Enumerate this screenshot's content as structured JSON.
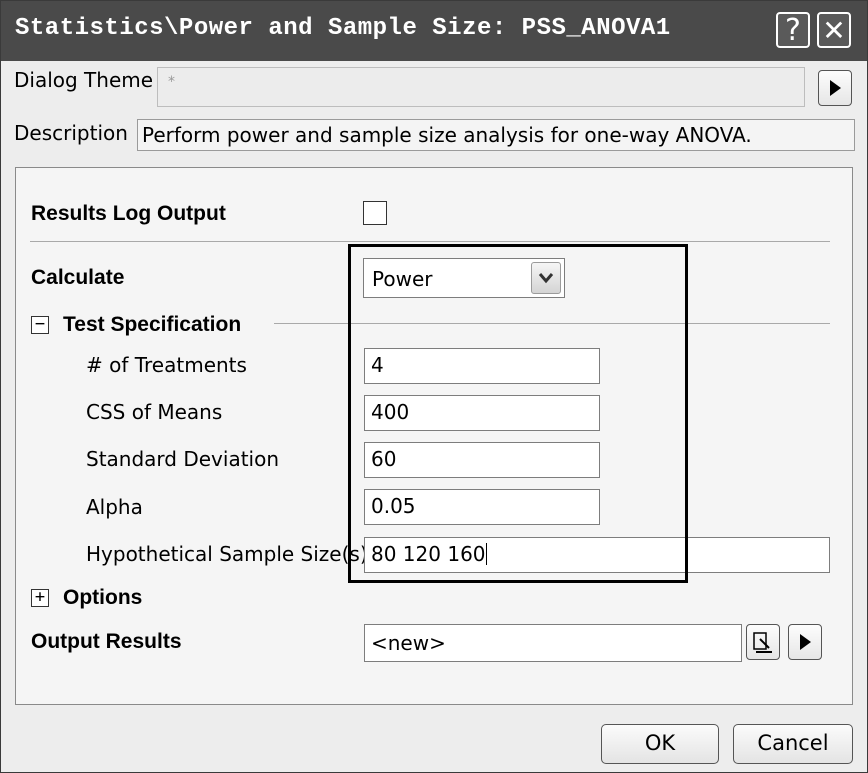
{
  "window": {
    "title": "Statistics\\Power and Sample Size: PSS_ANOVA1",
    "help_glyph": "?",
    "close_glyph": "✕"
  },
  "header": {
    "dialog_theme_label": "Dialog Theme",
    "dialog_theme_value": "*",
    "description_label": "Description",
    "description_text": "Perform power and sample size analysis for one-way ANOVA."
  },
  "form": {
    "results_log_label": "Results Log Output",
    "results_log_checked": false,
    "calculate_label": "Calculate",
    "calculate_value": "Power",
    "test_spec_label": "Test Specification",
    "test_spec_toggle": "−",
    "fields": {
      "treatments_label": "# of Treatments",
      "treatments_value": "4",
      "css_label": "CSS of Means",
      "css_value": "400",
      "sd_label": "Standard Deviation",
      "sd_value": "60",
      "alpha_label": "Alpha",
      "alpha_value": "0.05",
      "sample_label": "Hypothetical Sample Size(s)",
      "sample_value": "80 120 160"
    },
    "options_label": "Options",
    "options_toggle": "+",
    "output_label": "Output Results",
    "output_value": "<new>"
  },
  "footer": {
    "ok_label": "OK",
    "cancel_label": "Cancel"
  },
  "colors": {
    "titlebar": "#4a4a4a",
    "dialog_bg": "#ededed",
    "panel_bg": "#f5f5f5",
    "highlight_border": "#000000"
  },
  "icons": [
    "help-icon",
    "close-icon",
    "arrow-right-icon",
    "dropdown-chevron-icon",
    "collapse-icon",
    "expand-icon",
    "browse-icon"
  ]
}
